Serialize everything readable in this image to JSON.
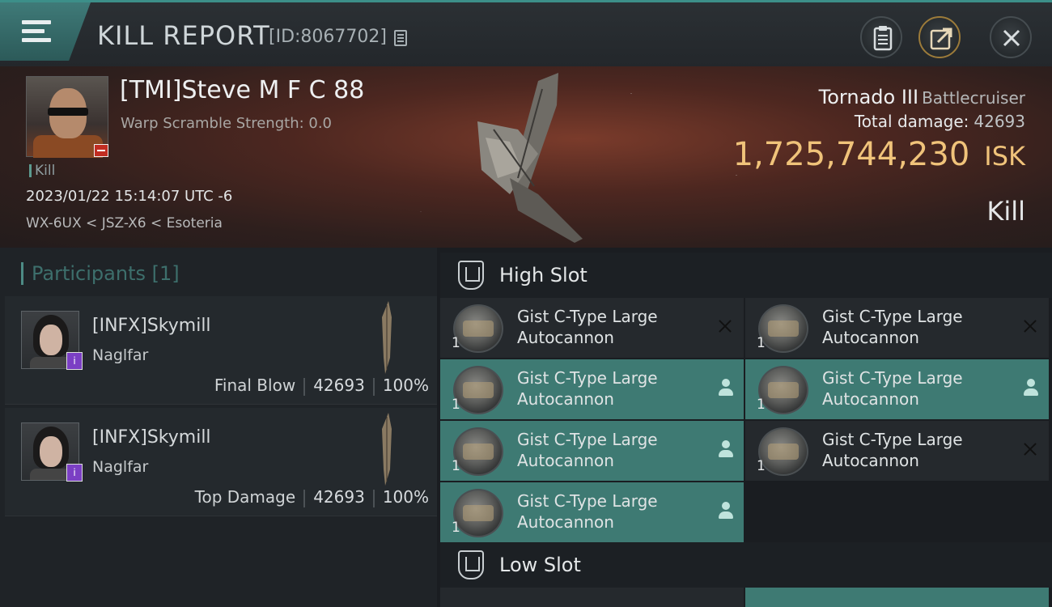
{
  "header": {
    "title": "KILL REPORT",
    "report_id": "[ID:8067702]"
  },
  "victim": {
    "name": "[TMI]Steve M F C 88",
    "scramble": "Warp Scramble Strength: 0.0",
    "tag": "Kill",
    "datetime": "2023/01/22 15:14:07 UTC -6",
    "location": "WX-6UX < JSZ-X6 < Esoteria",
    "ship_name": "Tornado III",
    "ship_class": "Battlecruiser",
    "total_damage_label": "Total damage:",
    "total_damage": "42693",
    "isk_value": "1,725,744,230",
    "isk_unit": "ISK",
    "result": "Kill"
  },
  "participants": {
    "header": "Participants [1]",
    "rows": [
      {
        "name": "[INFX]Skymill",
        "ship": "Naglfar",
        "role": "Final Blow",
        "damage": "42693",
        "percent": "100%"
      },
      {
        "name": "[INFX]Skymill",
        "ship": "Naglfar",
        "role": "Top Damage",
        "damage": "42693",
        "percent": "100%"
      }
    ]
  },
  "slots": {
    "high_title": "High Slot",
    "low_title": "Low Slot",
    "high_items": [
      {
        "name": "Gist C-Type Large Autocannon",
        "qty": "1",
        "state": "destroyed"
      },
      {
        "name": "Gist C-Type Large Autocannon",
        "qty": "1",
        "state": "destroyed"
      },
      {
        "name": "Gist C-Type Large Autocannon",
        "qty": "1",
        "state": "dropped"
      },
      {
        "name": "Gist C-Type Large Autocannon",
        "qty": "1",
        "state": "dropped"
      },
      {
        "name": "Gist C-Type Large Autocannon",
        "qty": "1",
        "state": "dropped"
      },
      {
        "name": "Gist C-Type Large Autocannon",
        "qty": "1",
        "state": "destroyed"
      },
      {
        "name": "Gist C-Type Large Autocannon",
        "qty": "1",
        "state": "dropped"
      }
    ]
  },
  "icons": {
    "menu": "menu-icon",
    "copy": "copy-icon",
    "clipboard": "clipboard-icon",
    "share": "share-icon",
    "close": "close-icon",
    "slot": "shield-icon",
    "dropped": "person-icon",
    "destroyed": "x-icon"
  },
  "colors": {
    "accent": "#3e7a73",
    "isk": "#f0c37a",
    "corp_badge": "#7b3fc4",
    "loss_badge": "#c12d22"
  }
}
